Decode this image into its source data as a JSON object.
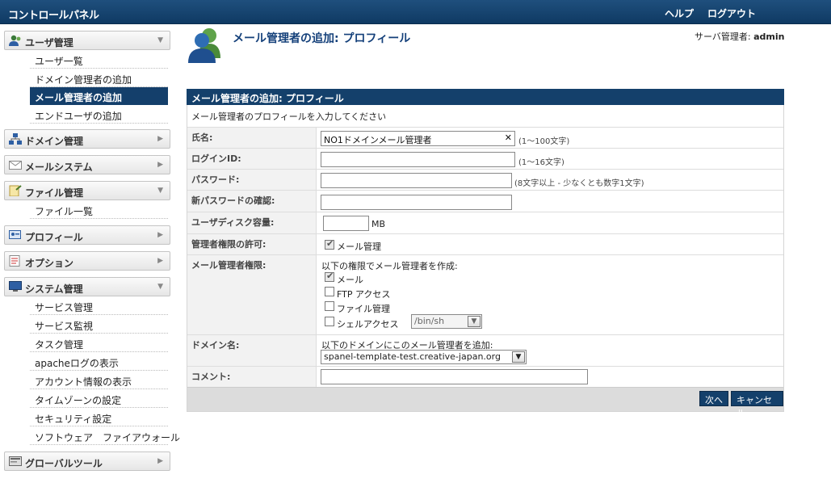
{
  "topbar": {
    "title": "コントロールパネル",
    "help": "ヘルプ",
    "logout": "ログアウト"
  },
  "sidebar": {
    "sections": [
      {
        "label": "ユーザ管理",
        "icon": "user-icon",
        "items": [
          "ユーザ一覧",
          "ドメイン管理者の追加",
          "メール管理者の追加",
          "エンドユーザの追加"
        ]
      },
      {
        "label": "ドメイン管理",
        "icon": "domain-icon",
        "items": []
      },
      {
        "label": "メールシステム",
        "icon": "mail-icon",
        "items": []
      },
      {
        "label": "ファイル管理",
        "icon": "file-icon",
        "items": [
          "ファイル一覧"
        ]
      },
      {
        "label": "プロフィール",
        "icon": "profile-icon",
        "items": []
      },
      {
        "label": "オプション",
        "icon": "options-icon",
        "items": []
      },
      {
        "label": "システム管理",
        "icon": "system-icon",
        "items": [
          "サービス管理",
          "サービス監視",
          "タスク管理",
          "apacheログの表示",
          "アカウント情報の表示",
          "タイムゾーンの設定",
          "セキュリティ設定",
          "ソフトウェア　ファイアウォール"
        ]
      },
      {
        "label": "グローバルツール",
        "icon": "tools-icon",
        "items": []
      }
    ],
    "active_item": "メール管理者の追加"
  },
  "header": {
    "title": "メール管理者の追加: プロフィール",
    "admin_prefix": "サーバ管理者: ",
    "admin_name": "admin"
  },
  "panel": {
    "title": "メール管理者の追加: プロフィール",
    "description": "メール管理者のプロフィールを入力してください",
    "fields": {
      "name": {
        "label": "氏名:",
        "value": "NO1ドメインメール管理者",
        "hint": "(1〜100文字)"
      },
      "login": {
        "label": "ログインID:",
        "value": "",
        "hint": "(1〜16文字)"
      },
      "password": {
        "label": "パスワード:",
        "value": "",
        "hint": "(8文字以上 - 少なくとも数字1文字)"
      },
      "confirm": {
        "label": "新パスワードの確認:",
        "value": ""
      },
      "quota": {
        "label": "ユーザディスク容量:",
        "value": "",
        "unit": "MB"
      },
      "admin_perm": {
        "label": "管理者権限の許可:",
        "option": "メール管理",
        "checked": true
      },
      "mail_perm": {
        "label": "メール管理者権限:",
        "intro": "以下の権限でメール管理者を作成:",
        "options": [
          {
            "label": "メール",
            "checked": true
          },
          {
            "label": "FTP アクセス",
            "checked": false
          },
          {
            "label": "ファイル管理",
            "checked": false
          },
          {
            "label": "シェルアクセス",
            "checked": false
          }
        ],
        "shell_value": "/bin/sh"
      },
      "domain": {
        "label": "ドメイン名:",
        "intro": "以下のドメインにこのメール管理者を追加:",
        "value": "spanel-template-test.creative-japan.org"
      },
      "comment": {
        "label": "コメント:",
        "value": ""
      }
    },
    "buttons": {
      "next": "次へ",
      "cancel": "キャンセル"
    }
  }
}
